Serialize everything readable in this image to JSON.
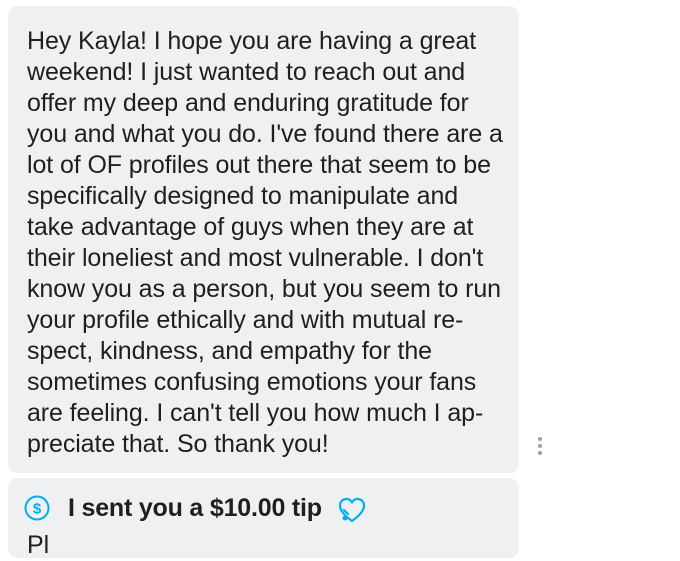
{
  "message": {
    "lines": [
      "Hey Kayla! I hope you are having a great",
      "weekend! I just wanted to reach out and",
      "offer my deep and enduring gratitude for",
      "you and what you do. I've found there are a",
      "lot of OF profiles out there that seem to be",
      "specifically designed to manipulate and",
      "take advantage of guys when they are at",
      "their loneliest and most vulnerable. I don't",
      "know you as a person, but you seem to run",
      "your profile ethically and with mutual re-",
      "spect, kindness, and empathy for the",
      "sometimes confusing emotions your fans",
      "are feeling. I can't tell you how much I ap-",
      "preciate that. So thank you!"
    ]
  },
  "more_options": {
    "icon": "more-vertical-icon"
  },
  "tip": {
    "icon": "dollar-circle-icon",
    "text": "I sent you a $10.00 tip",
    "heart_icon": "heart-outline-icon",
    "accent_color": "#00aff0"
  },
  "next_message": {
    "partial_text": "Pl"
  }
}
